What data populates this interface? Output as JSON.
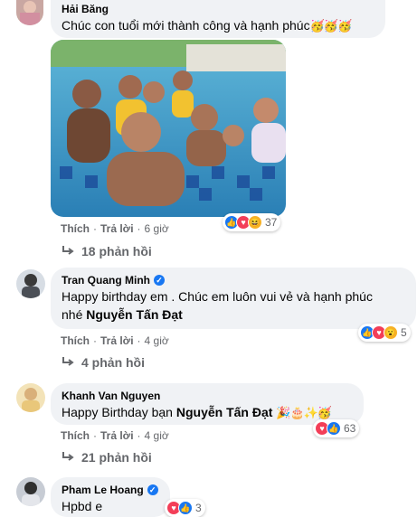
{
  "comments": [
    {
      "author": "Hải Băng",
      "text": "Chúc con tuổi mới thành công và hạnh phúc",
      "emojis": "🥳🥳🥳",
      "actions": {
        "like": "Thích",
        "reply": "Trả lời",
        "time": "6 giờ"
      },
      "reaction_count": "37",
      "replies": "18 phản hồi"
    },
    {
      "author": "Tran Quang Minh",
      "text_line1": "Happy birthday em . Chúc em luôn vui vẻ và hạnh phúc",
      "text_line2_prefix": "nhé",
      "tag": "Nguyễn Tấn Đạt",
      "actions": {
        "like": "Thích",
        "reply": "Trả lời",
        "time": "4 giờ"
      },
      "reaction_count": "5",
      "replies": "4 phản hồi"
    },
    {
      "author": "Khanh Van Nguyen",
      "text_prefix": "Happy Birthday bạn",
      "tag": "Nguyễn Tấn Đạt",
      "emojis": "🎉🎂✨🥳",
      "actions": {
        "like": "Thích",
        "reply": "Trả lời",
        "time": "4 giờ"
      },
      "reaction_count": "63",
      "replies": "21 phản hồi"
    },
    {
      "author": "Pham Le Hoang",
      "text": "Hpbd e",
      "reaction_count": "3"
    }
  ],
  "colors": {
    "bubble": "#f0f2f5",
    "muted": "#65676b",
    "like": "#1877f2",
    "love": "#f33e58",
    "emoji": "#f7b125"
  },
  "icons": {
    "reply_arrow": "reply-arrow-icon",
    "verified": "verified-badge-icon",
    "like": "like-reaction-icon",
    "love": "love-reaction-icon",
    "haha": "haha-reaction-icon"
  }
}
